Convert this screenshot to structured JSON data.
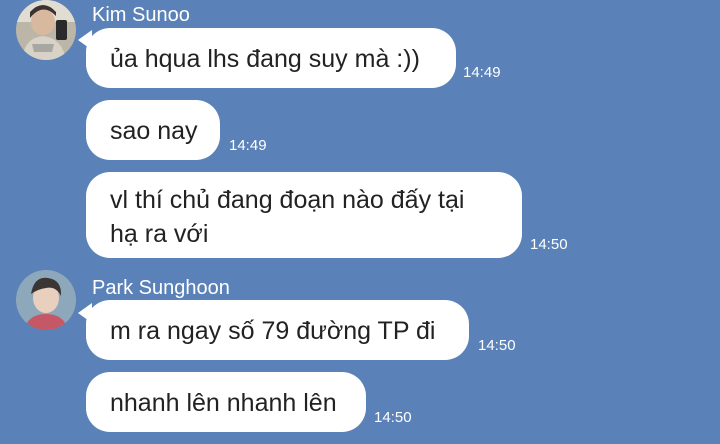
{
  "colors": {
    "background": "#5b82b8",
    "bubble": "#ffffff",
    "bubble_text": "#222222",
    "meta_text": "#ffffff"
  },
  "chat": {
    "sender_1": {
      "name": "Kim Sunoo",
      "avatar_icon": "person-photo-avatar-1",
      "messages": [
        {
          "text": "ủa hqua lhs đang suy mà :))",
          "time": "14:49"
        },
        {
          "text": "sao nay",
          "time": "14:49"
        },
        {
          "text": "vl thí chủ đang đoạn nào đấy tại hạ ra với",
          "time": "14:50"
        }
      ]
    },
    "sender_2": {
      "name": "Park Sunghoon",
      "avatar_icon": "person-photo-avatar-2",
      "messages": [
        {
          "text": "m ra ngay số 79 đường TP đi",
          "time": "14:50"
        },
        {
          "text": "nhanh lên nhanh lên",
          "time": "14:50"
        }
      ]
    }
  }
}
